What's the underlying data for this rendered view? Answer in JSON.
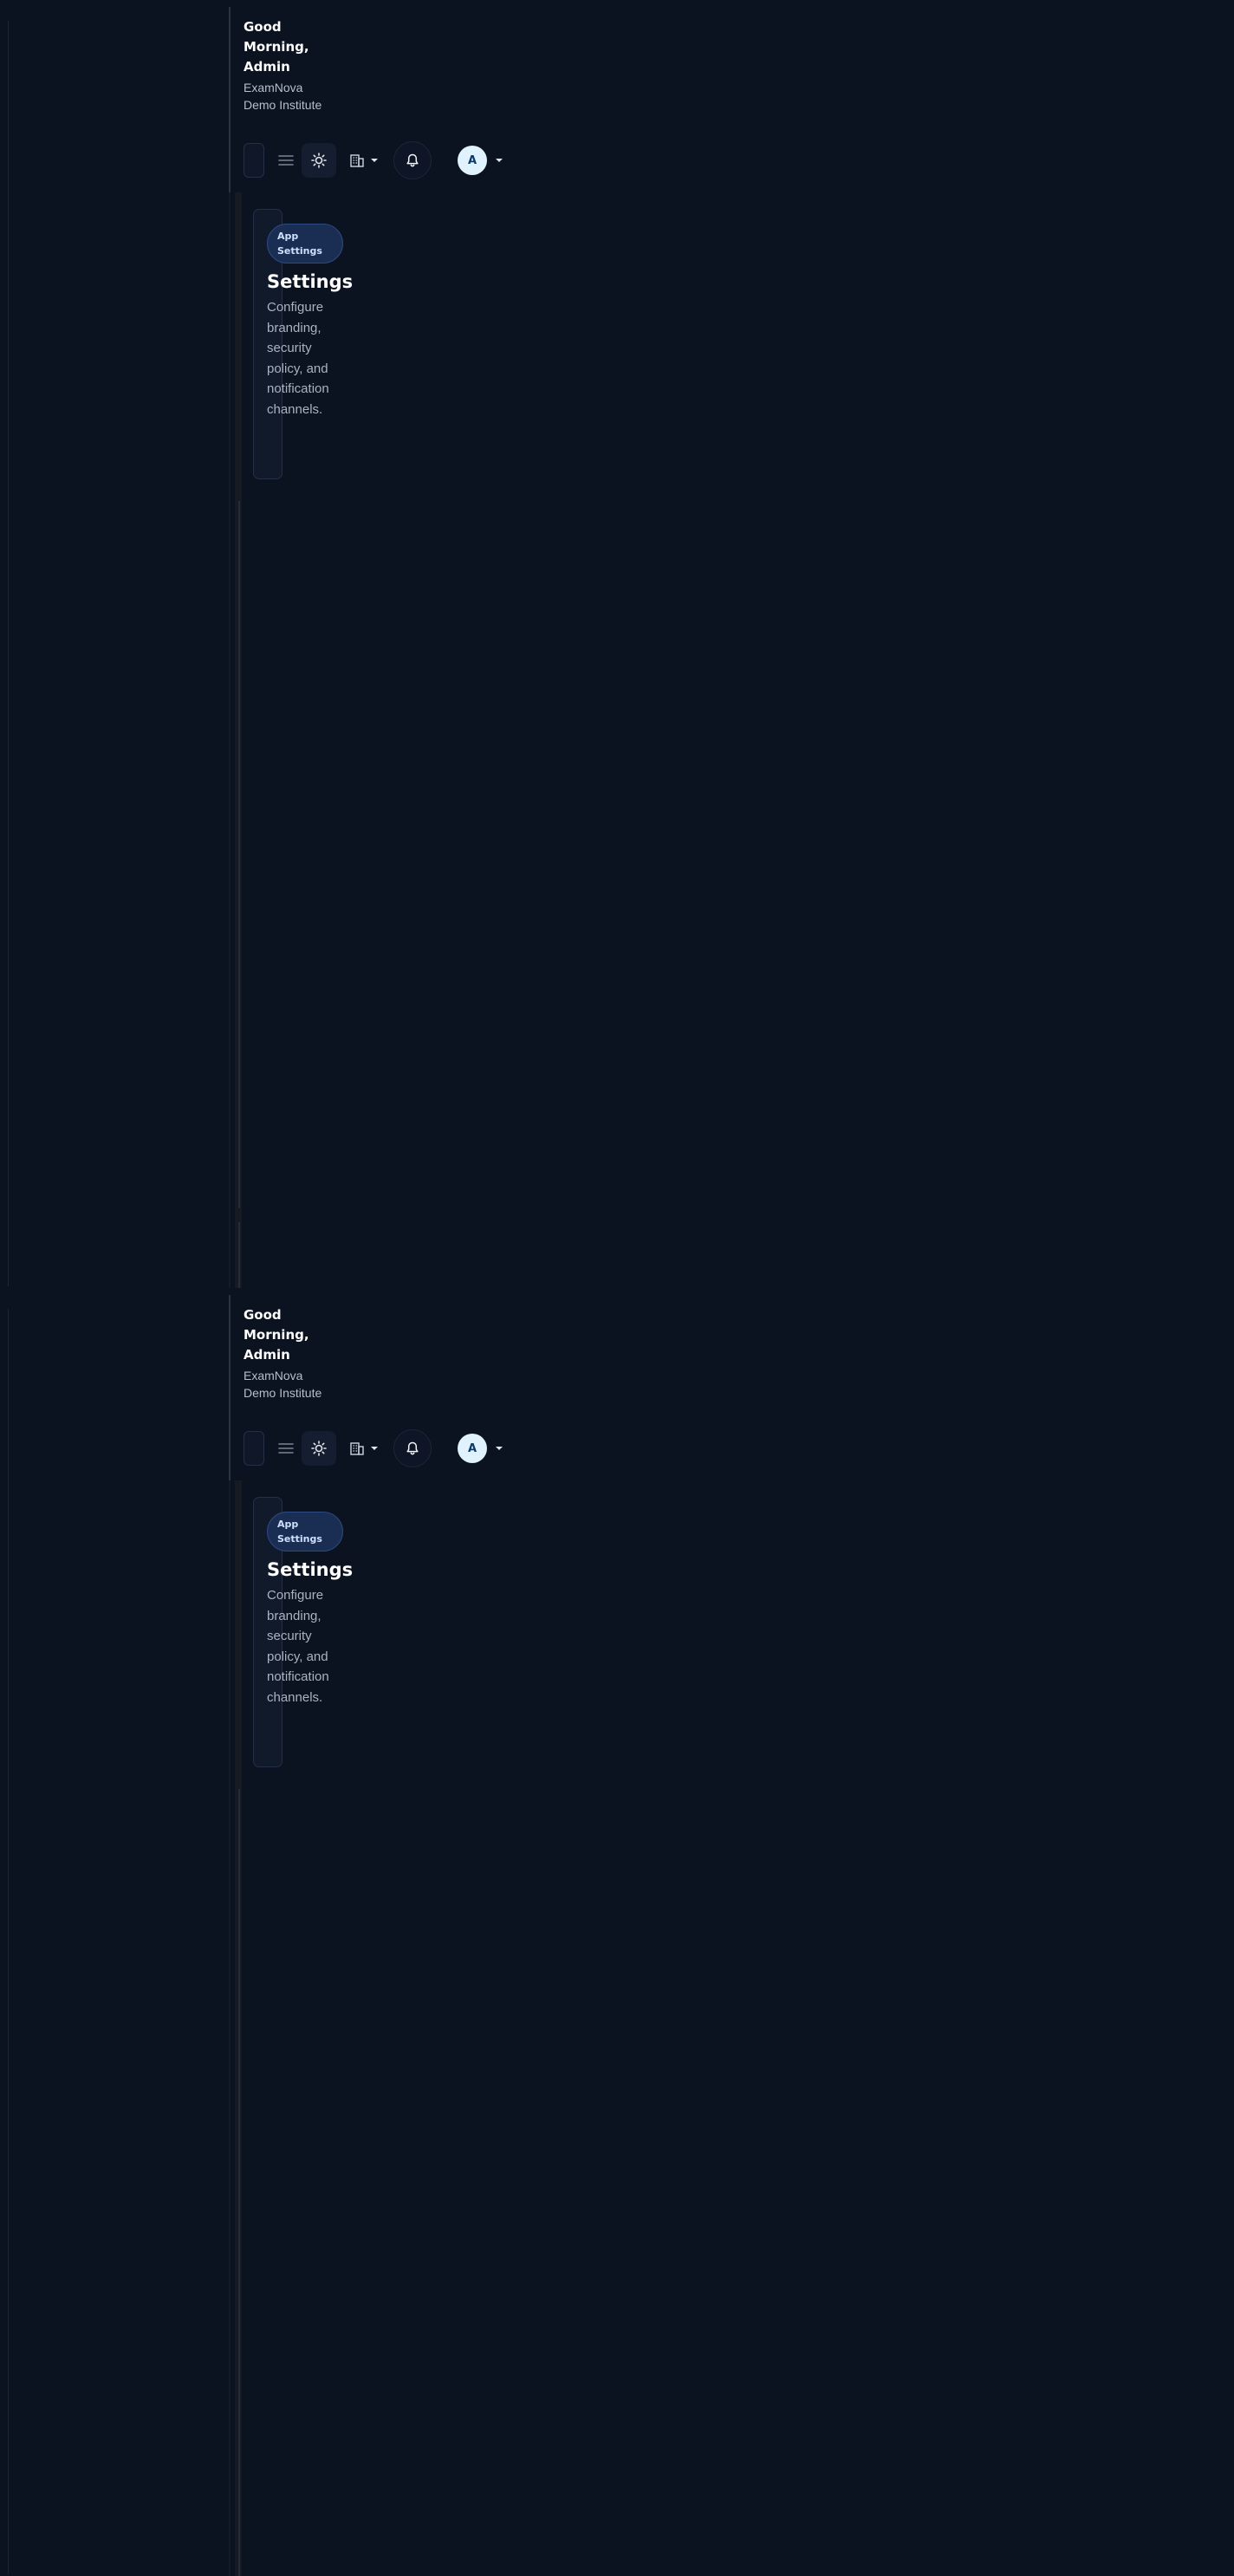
{
  "header": {
    "greeting": "Good Morning, Admin",
    "institute": "ExamNova Demo Institute"
  },
  "user": {
    "avatar_initial": "A"
  },
  "page": {
    "chip": "App Settings",
    "title": "Settings",
    "description": "Configure branding, security policy, and notification channels."
  },
  "icons": {
    "menu": "menu-icon",
    "theme": "sun-icon",
    "institute": "building-icon",
    "notifications": "bell-icon",
    "caret": "caret-down-icon"
  },
  "colors": {
    "background": "#0b1220",
    "avatar_bg": "#e0f2fe",
    "chip_bg": "#1a2d52"
  }
}
